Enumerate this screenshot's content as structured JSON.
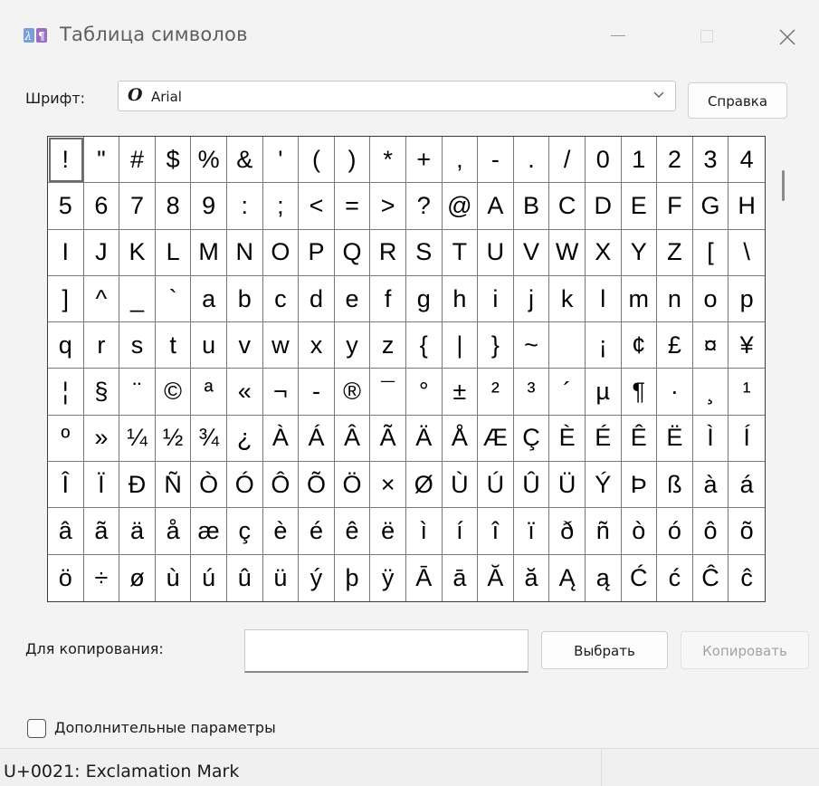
{
  "window": {
    "title": "Таблица символов"
  },
  "font_row": {
    "label": "Шрифт:",
    "glyph": "O",
    "value": "Arial",
    "help_label": "Справка"
  },
  "grid": {
    "rows": [
      [
        "!",
        "\"",
        "#",
        "$",
        "%",
        "&",
        "'",
        "(",
        ")",
        "*",
        "+",
        ",",
        "-",
        ".",
        "/",
        "0",
        "1",
        "2",
        "3",
        "4"
      ],
      [
        "5",
        "6",
        "7",
        "8",
        "9",
        ":",
        ";",
        "<",
        "=",
        ">",
        "?",
        "@",
        "A",
        "B",
        "C",
        "D",
        "E",
        "F",
        "G",
        "H"
      ],
      [
        "I",
        "J",
        "K",
        "L",
        "M",
        "N",
        "O",
        "P",
        "Q",
        "R",
        "S",
        "T",
        "U",
        "V",
        "W",
        "X",
        "Y",
        "Z",
        "[",
        "\\"
      ],
      [
        "]",
        "^",
        "_",
        "`",
        "a",
        "b",
        "c",
        "d",
        "e",
        "f",
        "g",
        "h",
        "i",
        "j",
        "k",
        "l",
        "m",
        "n",
        "o",
        "p"
      ],
      [
        "q",
        "r",
        "s",
        "t",
        "u",
        "v",
        "w",
        "x",
        "y",
        "z",
        "{",
        "|",
        "}",
        "~",
        " ",
        "¡",
        "¢",
        "£",
        "¤",
        "¥"
      ],
      [
        "¦",
        "§",
        "¨",
        "©",
        "ª",
        "«",
        "¬",
        "-",
        "®",
        "¯",
        "°",
        "±",
        "²",
        "³",
        "´",
        "µ",
        "¶",
        "·",
        "¸",
        "¹"
      ],
      [
        "º",
        "»",
        "¼",
        "½",
        "¾",
        "¿",
        "À",
        "Á",
        "Â",
        "Ã",
        "Ä",
        "Å",
        "Æ",
        "Ç",
        "È",
        "É",
        "Ê",
        "Ë",
        "Ì",
        "Í"
      ],
      [
        "Î",
        "Ï",
        "Ð",
        "Ñ",
        "Ò",
        "Ó",
        "Ô",
        "Õ",
        "Ö",
        "×",
        "Ø",
        "Ù",
        "Ú",
        "Û",
        "Ü",
        "Ý",
        "Þ",
        "ß",
        "à",
        "á"
      ],
      [
        "â",
        "ã",
        "ä",
        "å",
        "æ",
        "ç",
        "è",
        "é",
        "ê",
        "ë",
        "ì",
        "í",
        "î",
        "ï",
        "ð",
        "ñ",
        "ò",
        "ó",
        "ô",
        "õ"
      ],
      [
        "ö",
        "÷",
        "ø",
        "ù",
        "ú",
        "û",
        "ü",
        "ý",
        "þ",
        "ÿ",
        "Ā",
        "ā",
        "Ă",
        "ă",
        "Ą",
        "ą",
        "Ć",
        "ć",
        "Ĉ",
        "ĉ"
      ]
    ],
    "selected": "!"
  },
  "copy_row": {
    "label": "Для копирования:",
    "value": "",
    "select_label": "Выбрать",
    "copy_label": "Копировать"
  },
  "advanced": {
    "label": "Дополнительные параметры",
    "checked": false
  },
  "status": {
    "text": "U+0021: Exclamation Mark"
  }
}
